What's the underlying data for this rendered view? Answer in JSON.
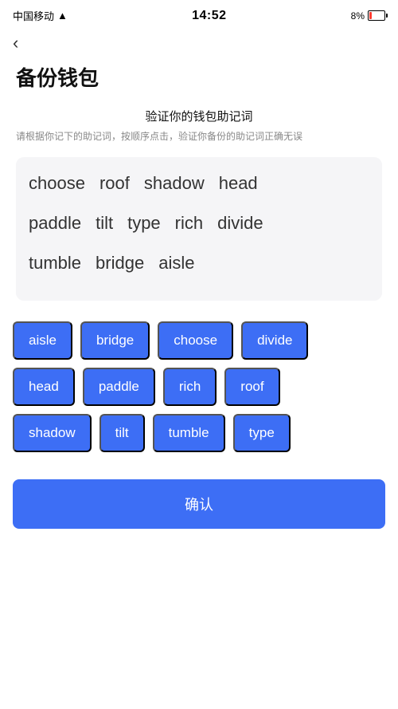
{
  "statusBar": {
    "carrier": "中国移动",
    "time": "14:52",
    "battery": "8%"
  },
  "header": {
    "backLabel": "‹",
    "pageTitle": "备份钱包"
  },
  "section": {
    "title": "验证你的钱包助记词",
    "desc": "请根据你记下的助记词，按顺序点击，验证你备份的助记词正确无误"
  },
  "wordCard": {
    "rows": [
      [
        "choose",
        "roof",
        "shadow",
        "head"
      ],
      [
        "paddle",
        "tilt",
        "type",
        "rich",
        "divide"
      ],
      [
        "tumble",
        "bridge",
        "aisle"
      ]
    ]
  },
  "chips": {
    "rows": [
      [
        "aisle",
        "bridge",
        "choose",
        "divide"
      ],
      [
        "head",
        "paddle",
        "rich",
        "roof"
      ],
      [
        "shadow",
        "tilt",
        "tumble",
        "type"
      ]
    ]
  },
  "confirmButton": {
    "label": "确认"
  }
}
